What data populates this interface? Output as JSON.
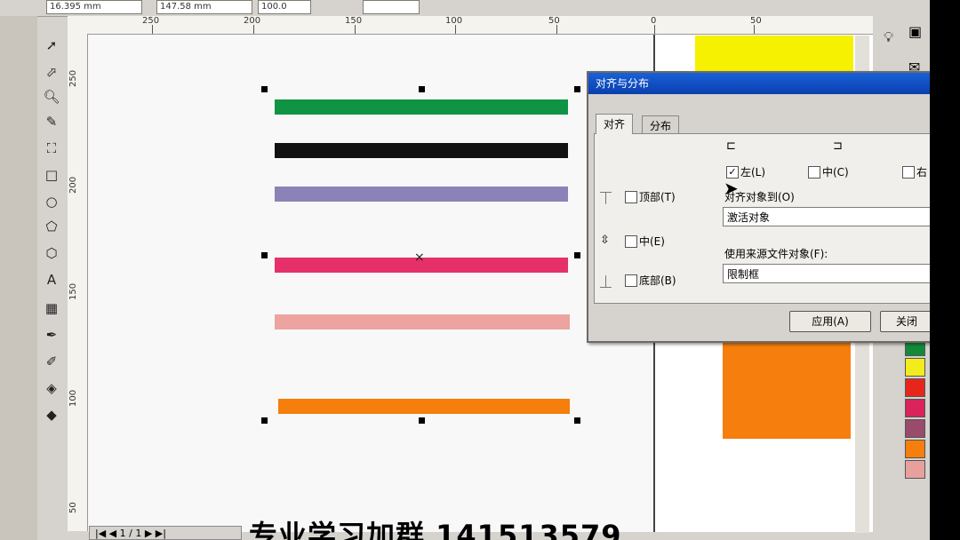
{
  "property_bar": {
    "x_field": "16.395 mm",
    "y_field": "147.58 mm",
    "percent_field": "100.0"
  },
  "h_ruler_labels": [
    "250",
    "200",
    "150",
    "100",
    "50",
    "0",
    "50"
  ],
  "v_ruler_labels": [
    "250",
    "200",
    "150",
    "100",
    "50"
  ],
  "canvas": {
    "bars": [
      {
        "color": "#0f9444"
      },
      {
        "color": "#111111"
      },
      {
        "color": "#8b83b8"
      },
      {
        "color": "#e5306a"
      },
      {
        "color": "#eda3a0"
      },
      {
        "color": "#f57e0c"
      }
    ],
    "objects": {
      "yellow": "#f5f100",
      "orange": "#f57e0c"
    }
  },
  "palette": [
    "#138a3a",
    "#f2ec1c",
    "#e6261c",
    "#d8245a",
    "#9a4a6a",
    "#f57e0c",
    "#e8a09c"
  ],
  "dialog": {
    "title": "对齐与分布",
    "tabs": [
      {
        "label": "对齐"
      },
      {
        "label": "分布"
      }
    ],
    "horizontal_options": [
      {
        "label": "左(L)",
        "checked": true
      },
      {
        "label": "中(C)",
        "checked": false
      },
      {
        "label": "右",
        "checked": false
      }
    ],
    "vertical_options": [
      {
        "label": "顶部(T)"
      },
      {
        "label": "中(E)"
      },
      {
        "label": "底部(B)"
      }
    ],
    "align_to_label": "对齐对象到(O)",
    "align_to_value": "激活对象",
    "source_label": "使用来源文件对象(F):",
    "source_value": "限制框",
    "apply_button": "应用(A)",
    "close_button": "关闭"
  },
  "watermark": "专业学习加群 141513579",
  "pager_text": "1 / 1"
}
